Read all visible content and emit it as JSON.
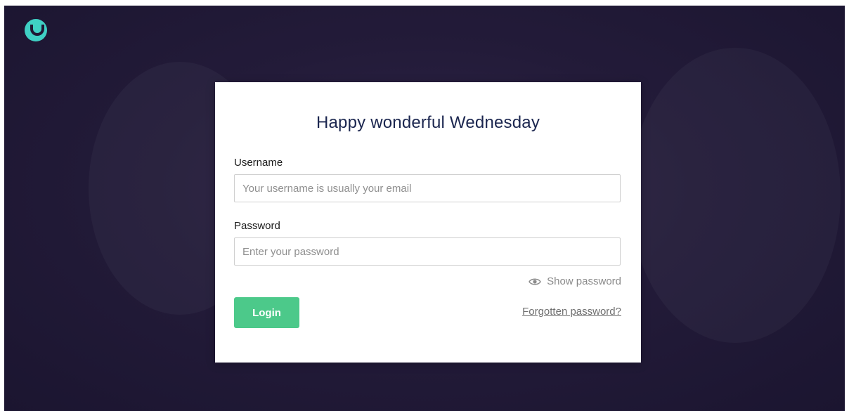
{
  "app": {
    "logo_icon": "umbraco-u-logo-icon",
    "logo_color": "#3fd0c4",
    "background_color": "#231b39"
  },
  "login": {
    "title": "Happy wonderful Wednesday",
    "username_label": "Username",
    "username_value": "",
    "username_placeholder": "Your username is usually your email",
    "password_label": "Password",
    "password_value": "",
    "password_placeholder": "Enter your password",
    "show_password_label": "Show password",
    "show_password_icon": "eye-icon",
    "login_button_label": "Login",
    "login_button_color": "#4cc98a",
    "forgot_password_label": "Forgotten password?"
  }
}
